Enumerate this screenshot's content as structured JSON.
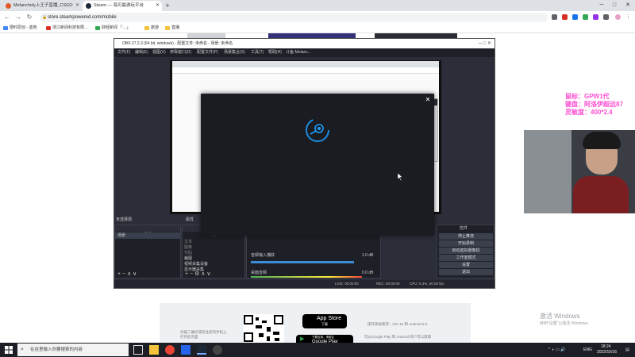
{
  "browser": {
    "tabs": [
      {
        "label": "Melancholy上王子直播_CSGO",
        "active": false
      },
      {
        "label": "Steam — 海贝最游玩平台",
        "active": true
      }
    ],
    "url": "store.steampowered.com/mobile",
    "bookmarks": [
      "限时原创 - 蓝地",
      "浙江新闻科技有限…",
      "财经新闻 「…」",
      "旅游",
      "直播"
    ]
  },
  "obs": {
    "title": "OBS 27.2.3 (64 bit, windows) - 配置文件: 未命名 - 场景: 未命名",
    "menu": [
      "文件(F)",
      "编辑(E)",
      "视图(V)",
      "停靠窗口(D)",
      "配置文件(P)",
      "场景集合(S)",
      "工具(T)",
      "帮助(H)",
      "斗鱼-Melanc..."
    ],
    "scenes_header": "未选择源",
    "properties_label": "属性",
    "scenes_col": "场景",
    "scene_item": "场景",
    "sources_col": "来源",
    "sources": [
      "文本",
      "图像",
      "代码",
      "裁图",
      "视频采集设备",
      "显示器采集"
    ],
    "audio_tracks": [
      {
        "label": "音频输入捕获",
        "db": "1.0 dB"
      },
      {
        "label": "桌面音频",
        "db": "0.0 dB"
      }
    ],
    "controls_header": "控件",
    "controls": [
      "停止推流",
      "开始录制",
      "启动虚拟摄像机",
      "工作室模式",
      "设置",
      "退出"
    ],
    "status": {
      "live": "LIVE: 00:00:00",
      "rec": "REC: 00:00:00",
      "cpu": "CPU: 5.3%, 60.00 fps"
    }
  },
  "overlay": {
    "lines": [
      "鼠标：GPW1代",
      "键盘：阿洛伊超远87",
      "灵敏度：400*2.4"
    ]
  },
  "steam_mobile": {
    "left_text": "扫描二维码或前往您的手机上打开此页面",
    "app_store_label": "App Store",
    "app_store_sub": "下载",
    "google_play_label": "Google Play",
    "google_play_sub": "下载应用，请前往",
    "req_ios": "操作系统要求：iOS 10 和 Android 5.0",
    "req_android": "可从Google Play 和 Android 商户可以获取"
  },
  "windows_activate": {
    "title": "激活 Windows",
    "sub": "转到“设置”以激活 Windows。"
  },
  "taskbar": {
    "search_placeholder": "在这里输入你要搜索的内容",
    "lang": "ENG",
    "time": "18:24",
    "date": "2022/10/16"
  },
  "colors": {
    "overlay_text": "#ff4fd2",
    "steam_blue": "#1a9fff"
  }
}
